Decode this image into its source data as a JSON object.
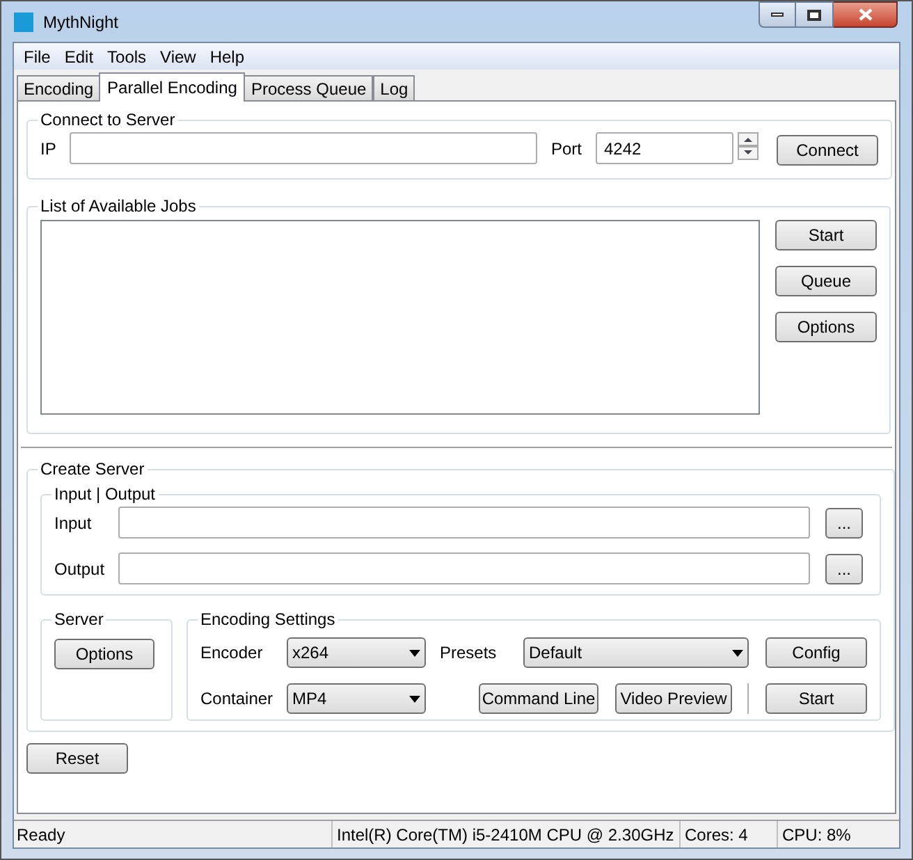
{
  "window": {
    "title": "MythNight"
  },
  "menu": [
    "File",
    "Edit",
    "Tools",
    "View",
    "Help"
  ],
  "tabs": [
    {
      "label": "Encoding",
      "selected": false
    },
    {
      "label": "Parallel Encoding",
      "selected": true
    },
    {
      "label": "Process Queue",
      "selected": false
    },
    {
      "label": "Log",
      "selected": false
    }
  ],
  "connect": {
    "title": "Connect to Server",
    "ip_label": "IP",
    "port_label": "Port",
    "port_value": "4242",
    "button": "Connect"
  },
  "jobs": {
    "title": "List of Available Jobs",
    "buttons": [
      "Start",
      "Queue",
      "Options"
    ]
  },
  "create_server": {
    "title": "Create Server",
    "io": {
      "title": "Input | Output",
      "fields": [
        {
          "label": "Input",
          "button": "..."
        },
        {
          "label": "Output",
          "button": "..."
        }
      ]
    },
    "server": {
      "title": "Server",
      "button": "Options"
    },
    "encoding": {
      "title": "Encoding Settings",
      "encoder_label": "Encoder",
      "encoder_value": "x264",
      "presets_label": "Presets",
      "presets_value": "Default",
      "container_label": "Container",
      "container_value": "MP4",
      "config_button": "Config",
      "command_line_button": "Command Line",
      "video_preview_button": "Video Preview",
      "start_button": "Start"
    }
  },
  "reset_button": "Reset",
  "status_bar": [
    "Ready",
    "Intel(R) Core(TM) i5-2410M CPU @ 2.30GHz",
    "Cores: 4",
    "CPU: 8%"
  ]
}
